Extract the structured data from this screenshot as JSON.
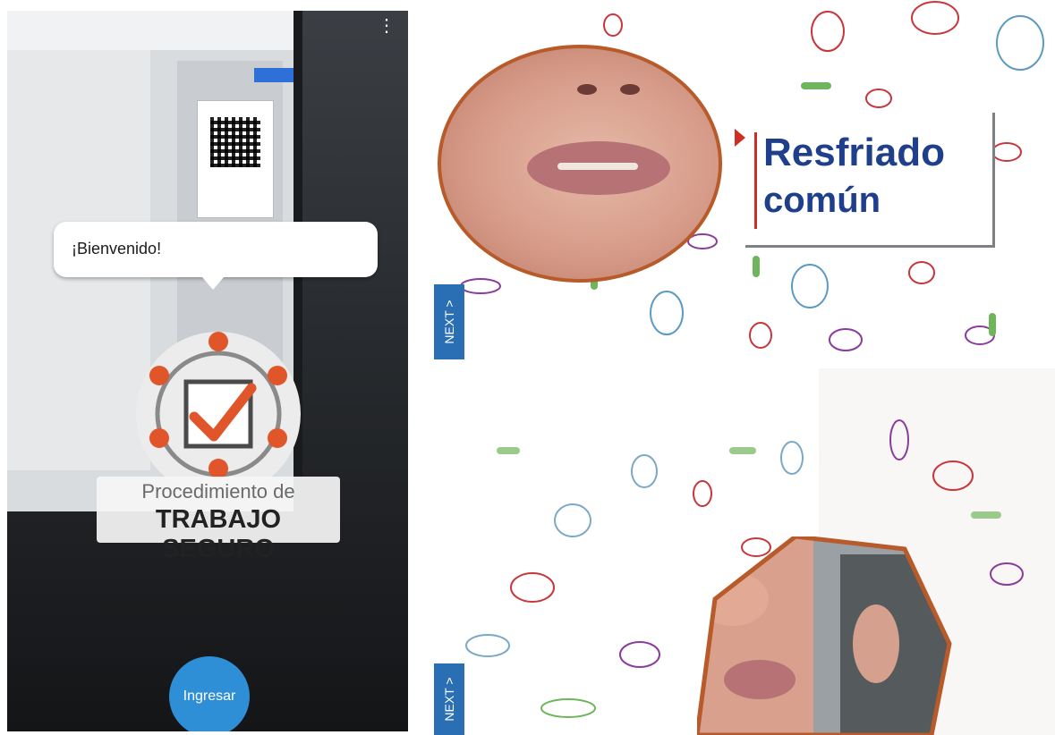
{
  "left_phone": {
    "menu_icon": "vertical-ellipsis-icon",
    "bubble_text": "¡Bienvenido!",
    "logo_line1": "Procedimiento de",
    "logo_line2": "TRABAJO SEGURO",
    "button_label": "Ingresar",
    "colors": {
      "button": "#2f8fd6",
      "logo_orange": "#e0562a",
      "logo_ring": "#8a8a8a"
    }
  },
  "right_top": {
    "title_line1": "Resfriado",
    "title_line2": "común",
    "next_label": "NEXT >",
    "colors": {
      "title": "#1f3f8c",
      "accent": "#cf2f22",
      "frame": "#b85a2a",
      "next_bg": "#2a6fb4"
    }
  },
  "right_bottom": {
    "next_label": "NEXT >"
  }
}
